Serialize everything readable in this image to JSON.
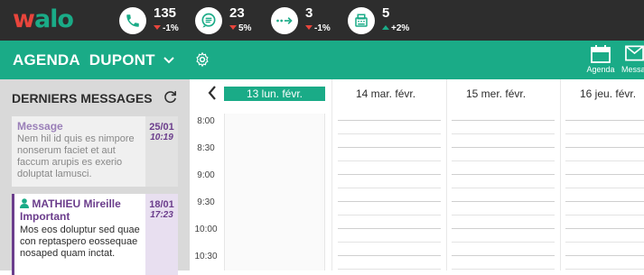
{
  "app": {
    "logo_first": "w",
    "logo_rest": "alo",
    "stats": [
      {
        "icon": "phone-icon",
        "value": "135",
        "delta": "-1%",
        "trend": "down"
      },
      {
        "icon": "chat-icon",
        "value": "23",
        "delta": "5%",
        "trend": "down"
      },
      {
        "icon": "transfer-icon",
        "value": "3",
        "delta": "-1%",
        "trend": "down"
      },
      {
        "icon": "fax-icon",
        "value": "5",
        "delta": "+2%",
        "trend": "up"
      }
    ]
  },
  "toolbar": {
    "title": "AGENDA",
    "user": "DUPONT",
    "buttons": [
      {
        "label": "Agenda",
        "icon": "calendar-icon"
      },
      {
        "label": "Messa",
        "icon": "mail-icon"
      }
    ]
  },
  "messages": {
    "title": "DERNIERS MESSAGES",
    "items": [
      {
        "subject": "Message",
        "text": "Nem hil id quis es nimpore nonserum faciet et aut faccum arupis es exerio doluptat lamusci.",
        "date": "25/01",
        "time": "10:19"
      },
      {
        "name": "MATHIEU Mireille",
        "subject": "Important",
        "text": "Mos eos doluptur sed quae con reptaspero eossequae nosaped quam inctat.",
        "date": "18/01",
        "time": "17:23"
      }
    ]
  },
  "calendar": {
    "days": [
      "13 lun. févr.",
      "14 mar. févr.",
      "15 mer. févr.",
      "16 jeu. févr."
    ],
    "times": [
      "8:00",
      "8:30",
      "9:00",
      "9:30",
      "10:00",
      "10:30"
    ]
  },
  "colors": {
    "brand": "#1aab87",
    "dark": "#2d2d2d",
    "alert": "#e8453c",
    "purple": "#6b3d8c"
  }
}
